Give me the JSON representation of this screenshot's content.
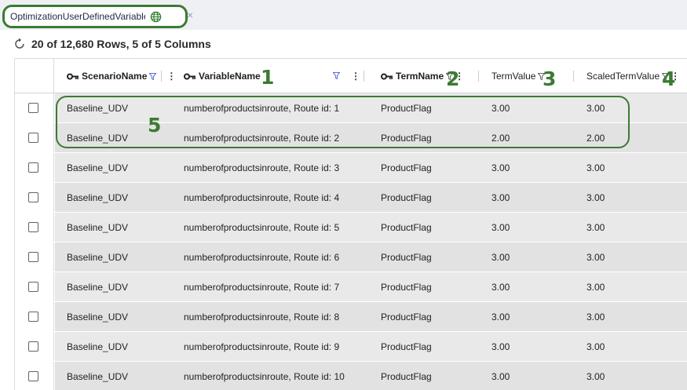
{
  "tab": {
    "title": "OptimizationUserDefinedVariableTe",
    "close": "×"
  },
  "toolbar": {
    "row_count": "20 of 12,680 Rows, 5 of 5 Columns"
  },
  "columns": [
    {
      "label": "ScenarioName",
      "key": true
    },
    {
      "label": "VariableName",
      "key": true
    },
    {
      "label": "TermName",
      "key": true
    },
    {
      "label": "TermValue",
      "key": false
    },
    {
      "label": "ScaledTermValue",
      "key": false
    }
  ],
  "rows": [
    [
      "Baseline_UDV",
      "numberofproductsinroute, Route id: 1",
      "ProductFlag",
      "3.00",
      "3.00"
    ],
    [
      "Baseline_UDV",
      "numberofproductsinroute, Route id: 2",
      "ProductFlag",
      "2.00",
      "2.00"
    ],
    [
      "Baseline_UDV",
      "numberofproductsinroute, Route id: 3",
      "ProductFlag",
      "3.00",
      "3.00"
    ],
    [
      "Baseline_UDV",
      "numberofproductsinroute, Route id: 4",
      "ProductFlag",
      "3.00",
      "3.00"
    ],
    [
      "Baseline_UDV",
      "numberofproductsinroute, Route id: 5",
      "ProductFlag",
      "3.00",
      "3.00"
    ],
    [
      "Baseline_UDV",
      "numberofproductsinroute, Route id: 6",
      "ProductFlag",
      "3.00",
      "3.00"
    ],
    [
      "Baseline_UDV",
      "numberofproductsinroute, Route id: 7",
      "ProductFlag",
      "3.00",
      "3.00"
    ],
    [
      "Baseline_UDV",
      "numberofproductsinroute, Route id: 8",
      "ProductFlag",
      "3.00",
      "3.00"
    ],
    [
      "Baseline_UDV",
      "numberofproductsinroute, Route id: 9",
      "ProductFlag",
      "3.00",
      "3.00"
    ],
    [
      "Baseline_UDV",
      "numberofproductsinroute, Route id: 10",
      "ProductFlag",
      "3.00",
      "3.00"
    ]
  ],
  "annotations": [
    "1",
    "2",
    "3",
    "4",
    "5"
  ],
  "colors": {
    "annotation": "#3c7a33",
    "row_band_even": "#e9e9e9",
    "row_band_odd": "#e2e2e2",
    "filter": "#4a5bd0"
  }
}
